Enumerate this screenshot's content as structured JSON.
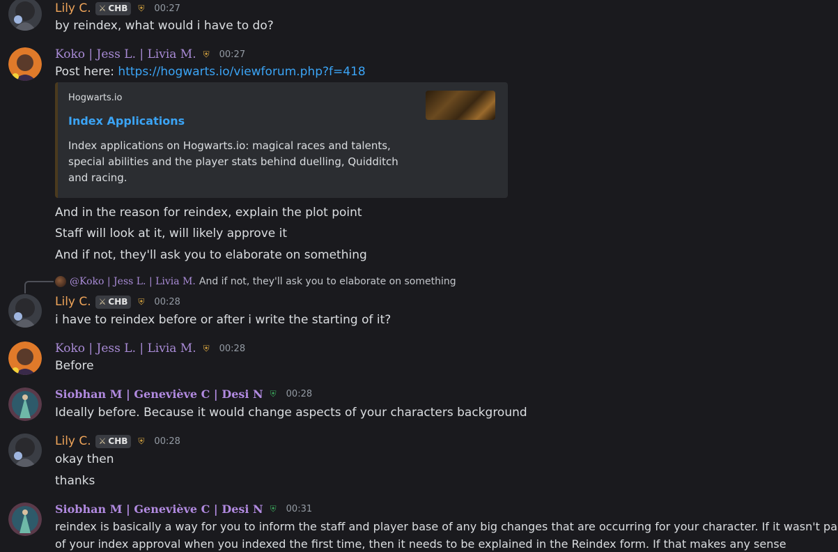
{
  "users": {
    "lily": {
      "name": "Lily C.",
      "tag": "CHB",
      "color": "#f0a55a"
    },
    "koko": {
      "name": "Koko | Jess L. | Livia M.",
      "color": "#a98bd6"
    },
    "siobhan": {
      "name": "Siobhan M | Geneviève C | Desi N",
      "color": "#b18ae0"
    }
  },
  "messages": [
    {
      "author": "Lily C.",
      "tag": "CHB",
      "time": "00:27",
      "lines": [
        "by reindex, what would i have to do?"
      ]
    },
    {
      "author": "Koko | Jess L. | Livia M.",
      "time": "00:27",
      "lines": [
        "Post here: ",
        "And in the reason for reindex, explain the plot point",
        "Staff will look at it, will likely approve it",
        "And if not, they'll ask you to elaborate on something"
      ],
      "link": "https://hogwarts.io/viewforum.php?f=418",
      "embed": {
        "provider": "Hogwarts.io",
        "title": "Index Applications",
        "description": "Index applications on Hogwarts.io: magical races and talents, special abilities and the player stats behind duelling, Quidditch and racing."
      }
    },
    {
      "author": "Lily C.",
      "tag": "CHB",
      "time": "00:28",
      "reply": {
        "name": "@Koko | Jess L. | Livia M.",
        "text": "And if not, they'll ask you to elaborate on something"
      },
      "lines": [
        "i have to reindex before or after i write the starting of it?"
      ]
    },
    {
      "author": "Koko | Jess L. | Livia M.",
      "time": "00:28",
      "lines": [
        "Before"
      ]
    },
    {
      "author": "Siobhan M | Geneviève C | Desi N",
      "time": "00:28",
      "lines": [
        "Ideally before. Because it would change aspects of your characters background"
      ]
    },
    {
      "author": "Lily C.",
      "tag": "CHB",
      "time": "00:28",
      "lines": [
        "okay then",
        "thanks"
      ]
    },
    {
      "author": "Siobhan M | Geneviève C | Desi N",
      "time": "00:31",
      "lines": [
        "reindex is basically a way for you to inform the staff and player base of any big changes that are occurring for your character. If it wasn't part",
        "of your index approval when you indexed the first time, then it needs to be explained in the Reindex form. If that makes any sense"
      ]
    }
  ]
}
